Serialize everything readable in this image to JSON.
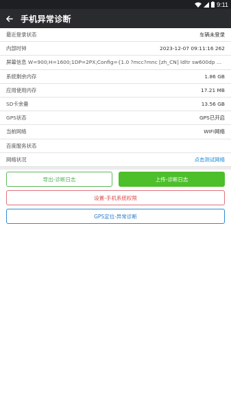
{
  "status_bar": {
    "time": "9:11"
  },
  "app_bar": {
    "title": "手机异常诊断"
  },
  "rows": [
    {
      "label": "最近登录状态",
      "value": "车辆未登录"
    },
    {
      "label": "内部时钟",
      "value": "2023-12-07 09:11:16 262"
    },
    {
      "label": "屏幕信息 W=900;H=1600;1DP=2PX;Config={1.0 ?mcc?mnc [zh_CN] ldltr sw600dp w600dp...",
      "value": ""
    },
    {
      "label": "系统剩余内存",
      "value": "1.86 GB"
    },
    {
      "label": "应用使用内存",
      "value": "17.21 MB"
    },
    {
      "label": "SD卡余量",
      "value": "13.56 GB"
    },
    {
      "label": "GPS状态",
      "value": "GPS已开启"
    },
    {
      "label": "当前网络",
      "value": "WIFI网络"
    },
    {
      "label": "百度服务状态",
      "value": ""
    },
    {
      "label": "网络状况",
      "value": "点击测试网络"
    }
  ],
  "buttons": {
    "export_log": "导出-诊断日志",
    "upload_log": "上传-诊断日志",
    "settings": "设置-手机系统权限",
    "gps": "GPS定位-异常诊断"
  },
  "colors": {
    "app_bar": "#2a2b2f",
    "green": "#4cbf2a",
    "red": "#e04a4a",
    "blue": "#2b7cc8",
    "link": "#1a8ad4"
  }
}
